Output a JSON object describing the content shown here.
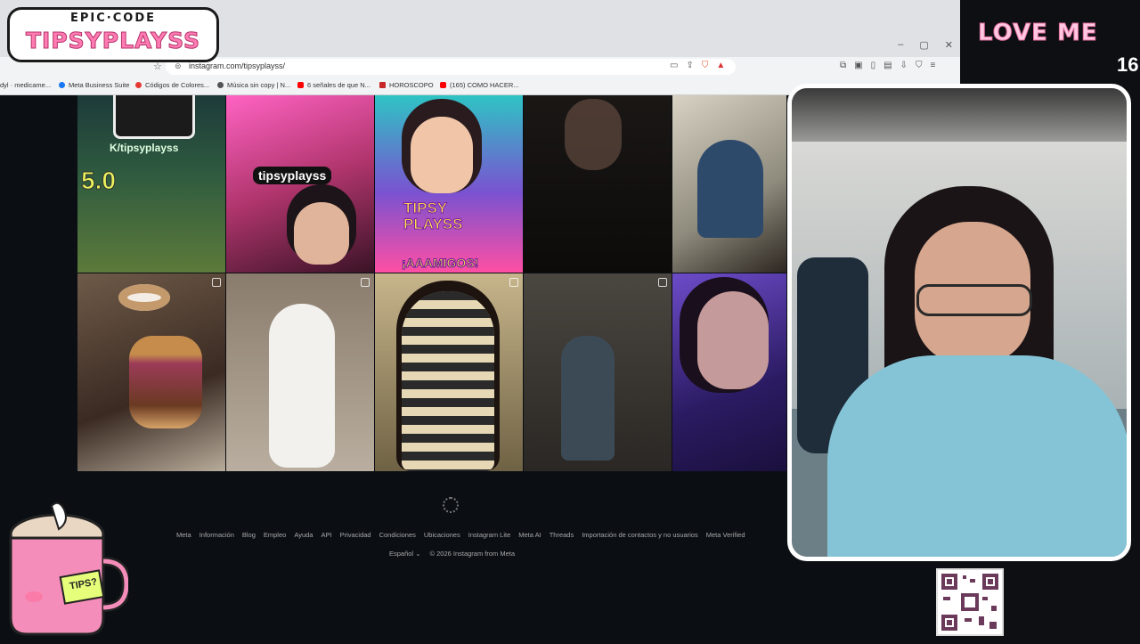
{
  "overlay": {
    "logo_top": "EPIC·CODE",
    "logo_main": "TIPSYPLAYSS",
    "love_text": "LOVE ME",
    "corner_number": "16",
    "mug_label": "TIPS?"
  },
  "browser": {
    "url": "instagram.com/tipsyplayss/",
    "window_controls": [
      "–",
      "▢",
      "✕"
    ]
  },
  "bookmarks": [
    {
      "label": "dyl · medicame...",
      "color": "#888"
    },
    {
      "label": "Meta Business Suite",
      "color": "#1877f2"
    },
    {
      "label": "Códigos de Colores...",
      "color": "#e53935"
    },
    {
      "label": "Música sin copy | N...",
      "color": "#555"
    },
    {
      "label": "6 señales de que N...",
      "color": "#ff0000"
    },
    {
      "label": "HOROSCOPO",
      "color": "#c62828"
    },
    {
      "label": "(165) COMO HACER...",
      "color": "#ff0000"
    }
  ],
  "grid": {
    "tile1_text": "K/tipsyplayss",
    "tile1_score": "5.0",
    "tile2_text": "tipsyplayss",
    "tile3_title": "TIPSY PLAYSS",
    "tile3_sub": "¡AAAMIGOS!"
  },
  "footer": {
    "links": [
      "Meta",
      "Información",
      "Blog",
      "Empleo",
      "Ayuda",
      "API",
      "Privacidad",
      "Condiciones",
      "Ubicaciones",
      "Instagram Lite",
      "Meta AI",
      "Threads",
      "Importación de contactos y no usuarios",
      "Meta Verified"
    ],
    "language": "Español",
    "copyright": "© 2026 Instagram from Meta"
  }
}
